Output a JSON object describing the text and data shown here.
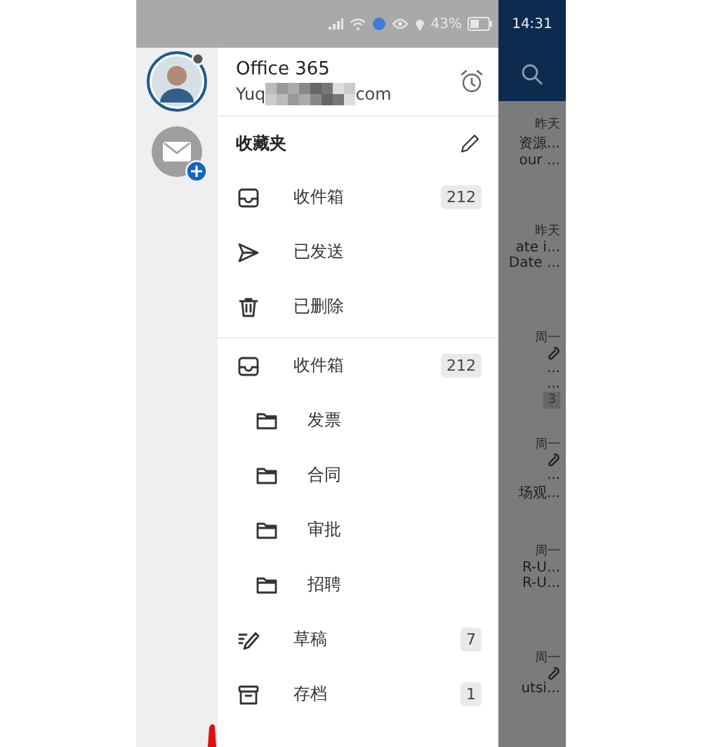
{
  "status_bar": {
    "battery": "43%",
    "time": "14:31"
  },
  "account": {
    "name": "Office 365",
    "email_start": "Yuq",
    "email_end": "com"
  },
  "favorites": {
    "title": "收藏夹",
    "items": [
      {
        "kind": "inbox",
        "label": "收件箱",
        "count": "212"
      },
      {
        "kind": "sent",
        "label": "已发送"
      },
      {
        "kind": "trash",
        "label": "已删除"
      }
    ]
  },
  "folders": [
    {
      "kind": "inbox",
      "label": "收件箱",
      "count": "212",
      "children": [
        {
          "kind": "folder",
          "label": "发票"
        },
        {
          "kind": "folder",
          "label": "合同"
        },
        {
          "kind": "folder",
          "label": "审批"
        },
        {
          "kind": "folder",
          "label": "招聘"
        }
      ]
    },
    {
      "kind": "drafts",
      "label": "草稿",
      "count": "7"
    },
    {
      "kind": "archive",
      "label": "存档",
      "count": "1"
    }
  ],
  "messages": [
    {
      "date": "昨天",
      "attachment": false,
      "lines": [
        "资源...",
        "our ..."
      ]
    },
    {
      "date": "昨天",
      "attachment": false,
      "lines": [
        "ate i...",
        "Date ..."
      ]
    },
    {
      "date": "周一",
      "attachment": true,
      "lines": [
        "...",
        "..."
      ],
      "badge": "3"
    },
    {
      "date": "周一",
      "attachment": true,
      "lines": [
        "...",
        "场观..."
      ]
    },
    {
      "date": "周一",
      "attachment": false,
      "lines": [
        "R-U...",
        "R-U..."
      ]
    },
    {
      "date": "周一",
      "attachment": true,
      "lines": [
        "utsi..."
      ]
    }
  ]
}
